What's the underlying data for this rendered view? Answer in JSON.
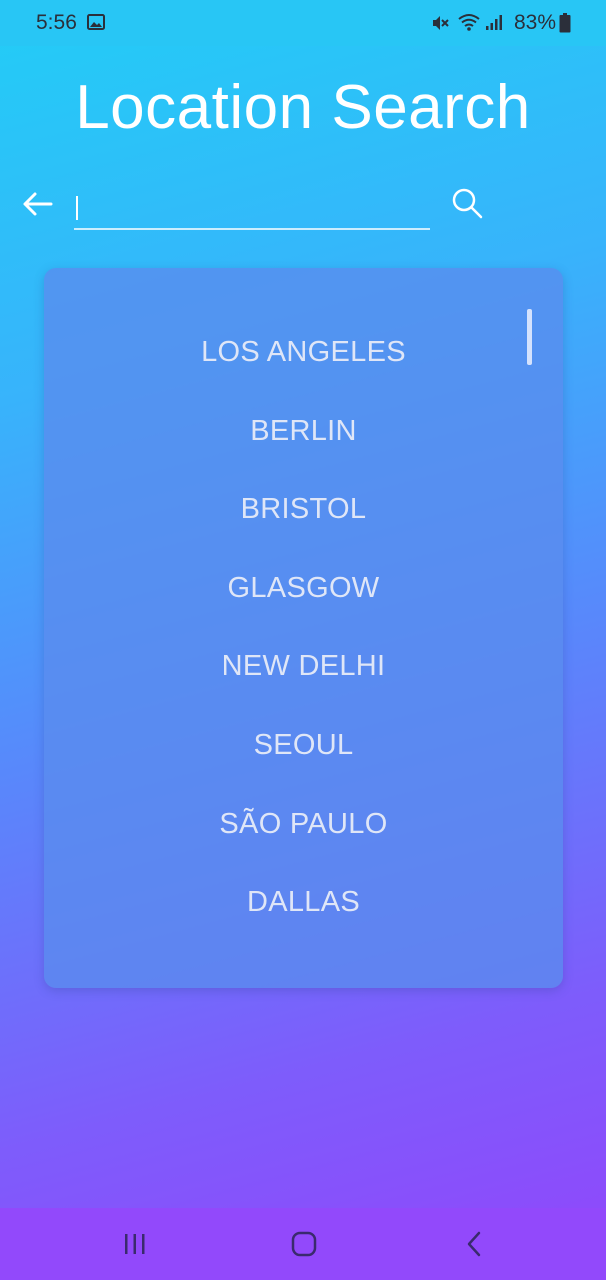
{
  "status_bar": {
    "time": "5:56",
    "battery_text": "83%",
    "icons": [
      "gallery-icon",
      "mute-icon",
      "wifi-icon",
      "signal-icon",
      "battery-icon"
    ]
  },
  "header": {
    "title": "Location Search"
  },
  "search": {
    "value": "",
    "placeholder": "",
    "back_icon": "arrow-left-icon",
    "search_icon": "search-icon"
  },
  "results": {
    "cities": [
      "LOS ANGELES",
      "BERLIN",
      "BRISTOL",
      "GLASGOW",
      "NEW DELHI",
      "SEOUL",
      "SÃO PAULO",
      "DALLAS"
    ]
  },
  "nav_bar": {
    "icons": [
      "recents-icon",
      "home-icon",
      "back-icon"
    ]
  },
  "colors": {
    "gradient_top": "#22cdf6",
    "gradient_bottom": "#9146fb",
    "card": "#5a8cee",
    "city_text": "#dfe6f7"
  }
}
